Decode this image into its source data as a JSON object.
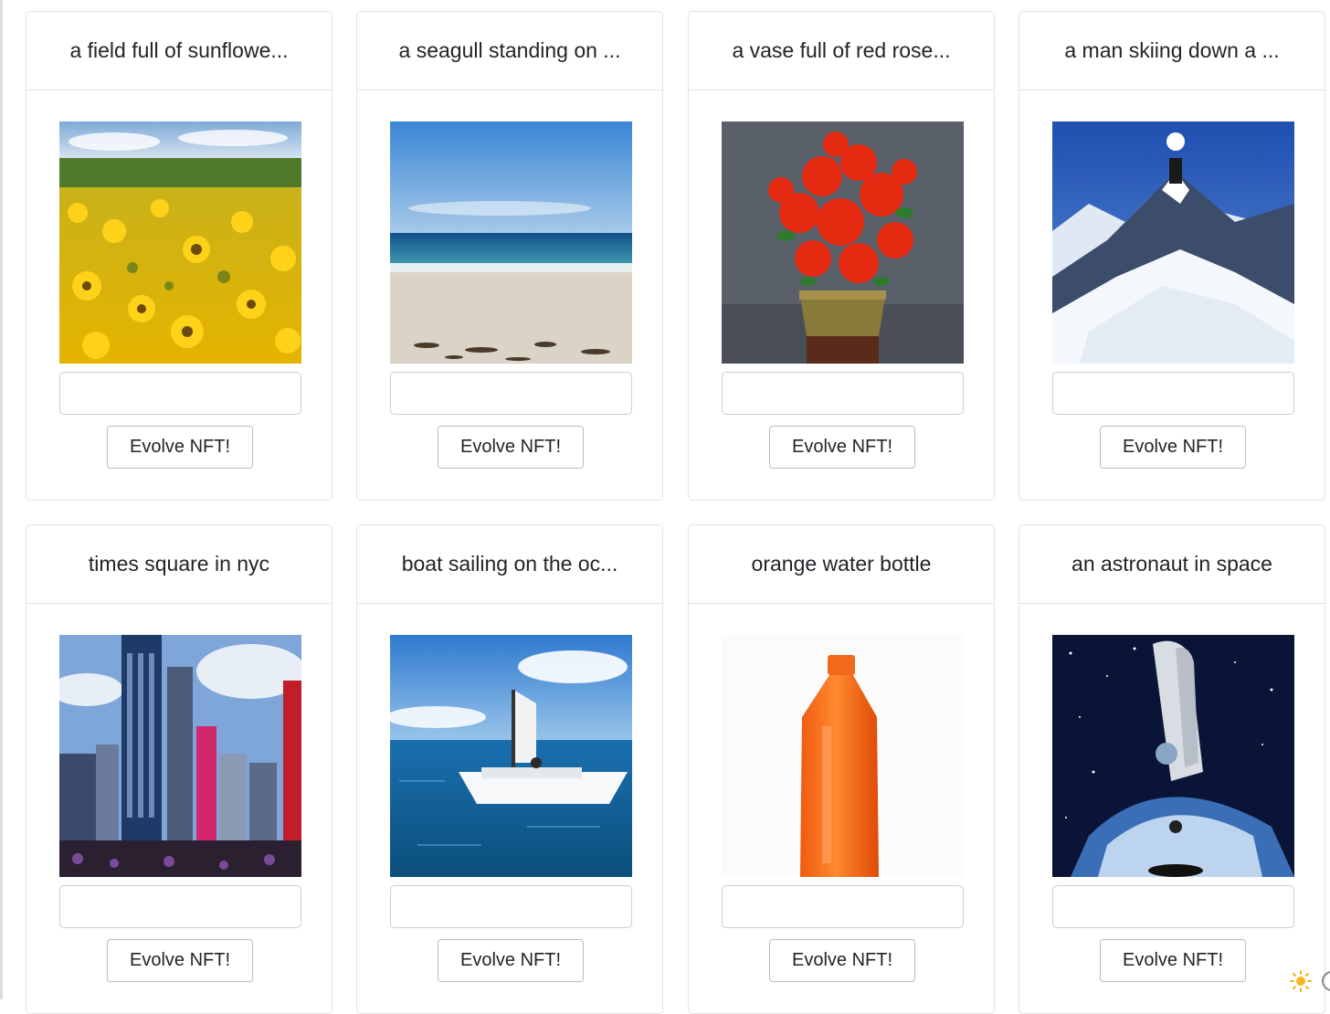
{
  "cards": [
    {
      "title": "a field full of sunflowe...",
      "input_value": "",
      "input_placeholder": "",
      "button_label": "Evolve NFT!",
      "image_subject": "sunflower-field"
    },
    {
      "title": "a seagull standing on ...",
      "input_value": "",
      "input_placeholder": "",
      "button_label": "Evolve NFT!",
      "image_subject": "beach-ocean"
    },
    {
      "title": "a vase full of red rose...",
      "input_value": "",
      "input_placeholder": "",
      "button_label": "Evolve NFT!",
      "image_subject": "red-flowers-vase"
    },
    {
      "title": "a man skiing down a ...",
      "input_value": "",
      "input_placeholder": "",
      "button_label": "Evolve NFT!",
      "image_subject": "snowy-mountain"
    },
    {
      "title": "times square in nyc",
      "input_value": "",
      "input_placeholder": "",
      "button_label": "Evolve NFT!",
      "image_subject": "city-skyline"
    },
    {
      "title": "boat sailing on the oc...",
      "input_value": "",
      "input_placeholder": "",
      "button_label": "Evolve NFT!",
      "image_subject": "boat-on-sea"
    },
    {
      "title": "orange water bottle",
      "input_value": "",
      "input_placeholder": "",
      "button_label": "Evolve NFT!",
      "image_subject": "orange-bottle"
    },
    {
      "title": "an astronaut in space",
      "input_value": "",
      "input_placeholder": "",
      "button_label": "Evolve NFT!",
      "image_subject": "astronaut-space"
    }
  ],
  "colors": {
    "card_border": "#e3e3e3",
    "text": "#212529",
    "button_border": "#b8bec4"
  },
  "icons": {
    "corner_left": "sun-icon",
    "corner_right": "circle-icon"
  }
}
